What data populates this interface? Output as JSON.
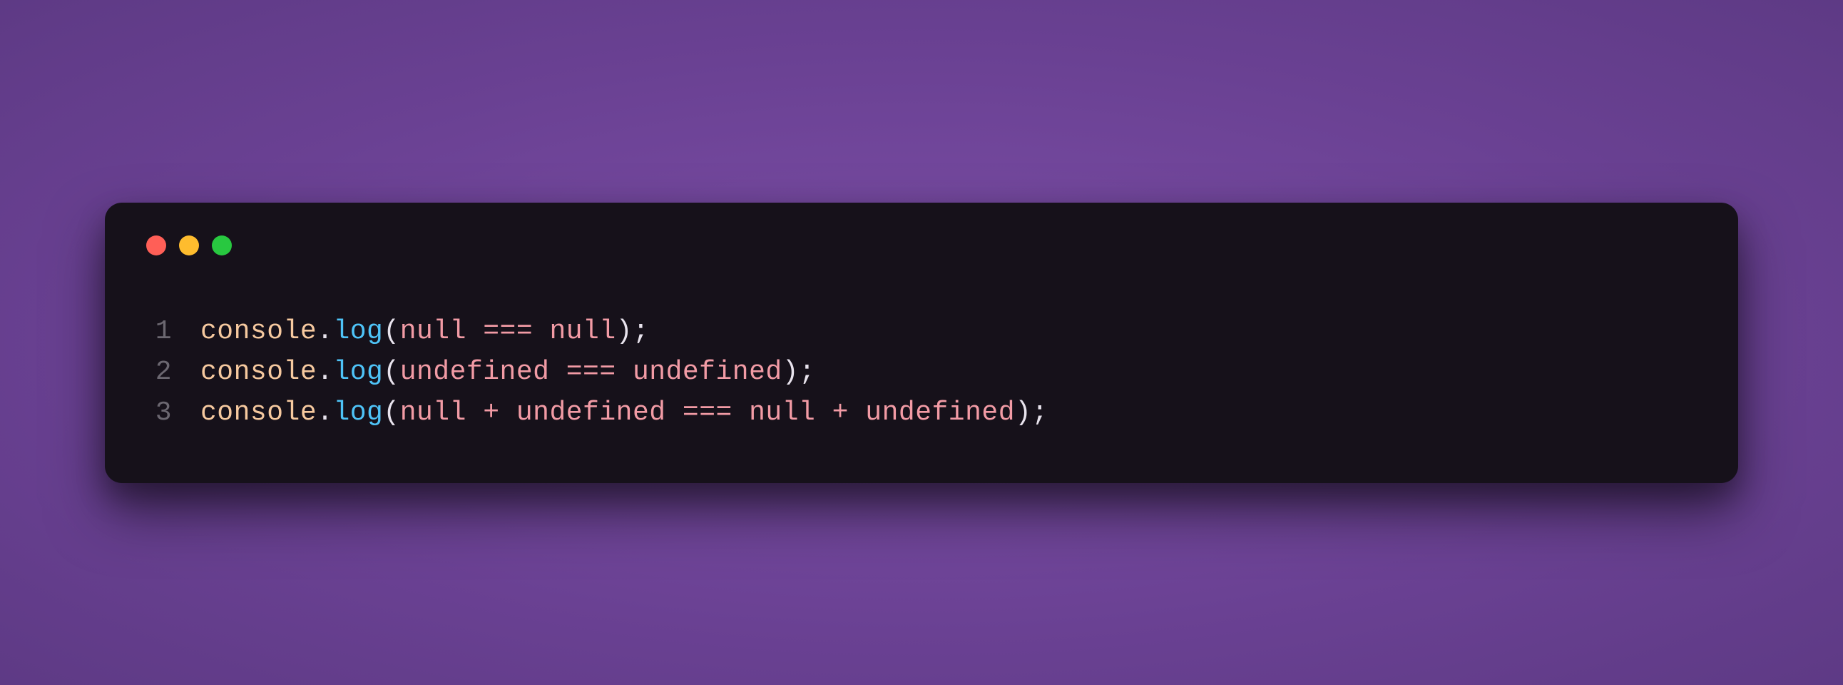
{
  "window": {
    "controls": {
      "close_color": "#ff5f57",
      "minimize_color": "#febc2e",
      "maximize_color": "#28c840"
    }
  },
  "code": {
    "lines": [
      {
        "number": "1",
        "tokens": {
          "console": "console",
          "dot1": ".",
          "log": "log",
          "lparen": "(",
          "null1": "null",
          "sp1": " ",
          "eq": "===",
          "sp2": " ",
          "null2": "null",
          "rparen": ")",
          "semi": ";"
        }
      },
      {
        "number": "2",
        "tokens": {
          "console": "console",
          "dot1": ".",
          "log": "log",
          "lparen": "(",
          "undef1": "undefined",
          "sp1": " ",
          "eq": "===",
          "sp2": " ",
          "undef2": "undefined",
          "rparen": ")",
          "semi": ";"
        }
      },
      {
        "number": "3",
        "tokens": {
          "console": "console",
          "dot1": ".",
          "log": "log",
          "lparen": "(",
          "null1": "null",
          "sp1": " ",
          "plus1": "+",
          "sp2": " ",
          "undef1": "undefined",
          "sp3": " ",
          "eq": "===",
          "sp4": " ",
          "null2": "null",
          "sp5": " ",
          "plus2": "+",
          "sp6": " ",
          "undef2": "undefined",
          "rparen": ")",
          "semi": ";"
        }
      }
    ]
  }
}
